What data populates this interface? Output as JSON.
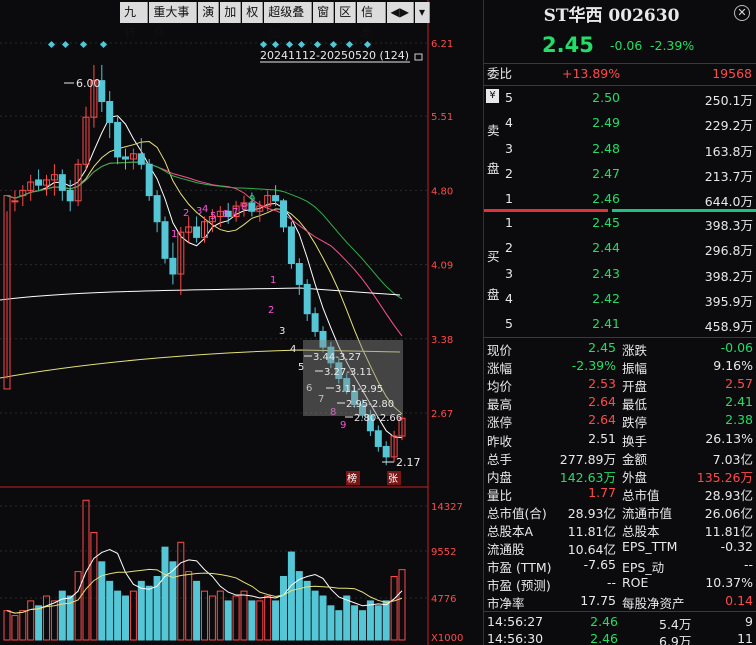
{
  "toolbar": {
    "items": [
      "九转",
      "重大事件",
      "演",
      "加",
      "权",
      "超级叠加",
      "窗",
      "区",
      "信息",
      "◀▶",
      "▾"
    ]
  },
  "chart": {
    "price_axis": [
      "6.21",
      "5.51",
      "4.80",
      "4.09",
      "3.38",
      "2.67"
    ],
    "vol_axis": [
      "14327",
      "9552",
      "4776",
      "X1000"
    ],
    "range_label": "20241112-20250520 (124)",
    "high_label": "6.00",
    "low_label": "2.17",
    "marks": [
      "榜",
      "张"
    ],
    "nine_turn_up": [
      "1",
      "2",
      "3",
      "4",
      "5",
      "6",
      "7",
      "8",
      "9"
    ],
    "nine_turn_down": [
      "1",
      "2",
      "3",
      "4",
      "5",
      "6",
      "7",
      "8",
      "9"
    ],
    "ladder": [
      "3.44-3.27",
      "3.27-3.11",
      "3.11-2.95",
      "2.95-2.80",
      "2.80-2.66"
    ]
  },
  "quote": {
    "title": "ST华西 002630",
    "price": "2.45",
    "change": "-0.06",
    "pct": "-2.39%"
  },
  "weibi": {
    "label": "委比",
    "pct": "+13.89%",
    "diff": "19568"
  },
  "sell_label": [
    "卖",
    "盘"
  ],
  "buy_label": [
    "买",
    "盘"
  ],
  "yen": "¥",
  "asks": [
    {
      "lv": "5",
      "price": "2.50",
      "vol": "250.1万"
    },
    {
      "lv": "4",
      "price": "2.49",
      "vol": "229.2万"
    },
    {
      "lv": "3",
      "price": "2.48",
      "vol": "163.8万"
    },
    {
      "lv": "2",
      "price": "2.47",
      "vol": "213.7万"
    },
    {
      "lv": "1",
      "price": "2.46",
      "vol": "644.0万"
    }
  ],
  "bids": [
    {
      "lv": "1",
      "price": "2.45",
      "vol": "398.3万"
    },
    {
      "lv": "2",
      "price": "2.44",
      "vol": "296.8万"
    },
    {
      "lv": "3",
      "price": "2.43",
      "vol": "398.2万"
    },
    {
      "lv": "4",
      "price": "2.42",
      "vol": "395.9万"
    },
    {
      "lv": "5",
      "price": "2.41",
      "vol": "458.9万"
    }
  ],
  "stats": [
    {
      "a": "现价",
      "b": "2.45",
      "bc": "green",
      "c": "涨跌",
      "d": "-0.06",
      "dc": "green"
    },
    {
      "a": "涨幅",
      "b": "-2.39%",
      "bc": "green",
      "c": "振幅",
      "d": "9.16%",
      "dc": "white"
    },
    {
      "a": "均价",
      "b": "2.53",
      "bc": "red",
      "c": "开盘",
      "d": "2.57",
      "dc": "red"
    },
    {
      "a": "最高",
      "b": "2.64",
      "bc": "red",
      "c": "最低",
      "d": "2.41",
      "dc": "green"
    },
    {
      "a": "涨停",
      "b": "2.64",
      "bc": "red",
      "c": "跌停",
      "d": "2.38",
      "dc": "green"
    },
    {
      "a": "昨收",
      "b": "2.51",
      "bc": "white",
      "c": "换手",
      "d": "26.13%",
      "dc": "white"
    },
    {
      "a": "总手",
      "b": "277.89万",
      "bc": "white",
      "c": "金额",
      "d": "7.03亿",
      "dc": "white"
    },
    {
      "a": "内盘",
      "b": "142.63万",
      "bc": "green",
      "c": "外盘",
      "d": "135.26万",
      "dc": "red"
    },
    {
      "a": "量比",
      "b": "1.77",
      "bc": "red",
      "c": "总市值",
      "d": "28.93亿",
      "dc": "white"
    },
    {
      "a": "总市值(合)",
      "b": "28.93亿",
      "bc": "white",
      "c": "流通市值",
      "d": "26.06亿",
      "dc": "white"
    },
    {
      "a": "总股本A",
      "b": "11.81亿",
      "bc": "white",
      "c": "总股本",
      "d": "11.81亿",
      "dc": "white"
    },
    {
      "a": "流通股",
      "b": "10.64亿",
      "bc": "white",
      "c": "EPS_TTM",
      "d": "-0.32",
      "dc": "white"
    },
    {
      "a": "市盈 (TTM)",
      "b": "-7.65",
      "bc": "white",
      "c": "EPS_动",
      "d": "--",
      "dc": "white"
    },
    {
      "a": "市盈 (预测)",
      "b": "--",
      "bc": "white",
      "c": "ROE",
      "d": "10.37%",
      "dc": "white"
    },
    {
      "a": "市净率",
      "b": "17.75",
      "bc": "white",
      "c": "每股净资产",
      "d": "0.14",
      "dc": "red"
    }
  ],
  "ticks": [
    {
      "time": "14:56:27",
      "price": "2.46",
      "vol": "5.4万",
      "n": "9"
    },
    {
      "time": "14:56:30",
      "price": "2.46",
      "vol": "6.9万",
      "n": "11"
    }
  ],
  "colors": {
    "up": "#ff4a4a",
    "down": "#22dd66",
    "flat_candle": "#54c6d6",
    "ma5": "#ffffff",
    "ma10": "#e6e07a",
    "ma20": "#ff4f8e",
    "ma30": "#2fb24a"
  }
}
